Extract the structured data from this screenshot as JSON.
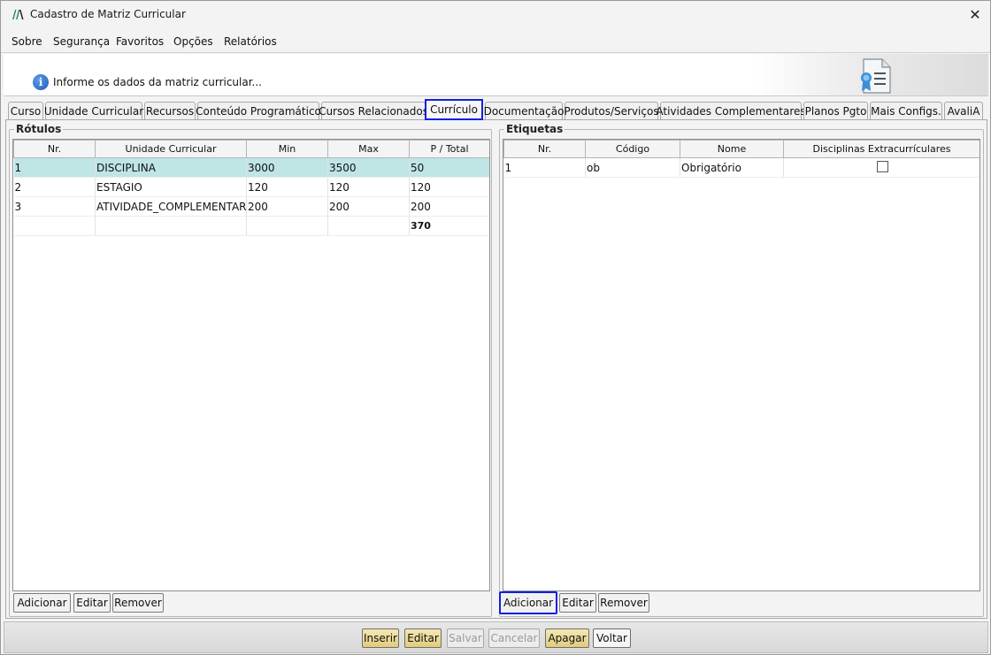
{
  "window": {
    "title": "Cadastro de Matriz Curricular",
    "close_glyph": "✕"
  },
  "menu": [
    {
      "label": "Sobre"
    },
    {
      "label": "Segurança"
    },
    {
      "label": "Favoritos"
    },
    {
      "label": "Opções"
    },
    {
      "label": "Relatórios"
    }
  ],
  "info": {
    "text": "Informe os dados da matriz curricular...",
    "icon": "info-icon",
    "illustration": "certificate-document-icon"
  },
  "tabs": [
    {
      "label": "Curso",
      "active": false
    },
    {
      "label": "Unidade Curricular",
      "active": false
    },
    {
      "label": "Recursos",
      "active": false
    },
    {
      "label": "Conteúdo Programático",
      "active": false
    },
    {
      "label": "Cursos Relacionados",
      "active": false
    },
    {
      "label": "Currículo",
      "active": true
    },
    {
      "label": "Documentação",
      "active": false
    },
    {
      "label": "Produtos/Serviços",
      "active": false
    },
    {
      "label": "Atividades Complementares",
      "active": false
    },
    {
      "label": "Planos Pgto",
      "active": false
    },
    {
      "label": "Mais Configs.",
      "active": false
    },
    {
      "label": "AvaliA",
      "active": false
    }
  ],
  "rotulos": {
    "title": "Rótulos",
    "columns": [
      "Nr.",
      "Unidade Curricular",
      "Min",
      "Max",
      "P / Total"
    ],
    "rows": [
      {
        "nr": "1",
        "unidade": "DISCIPLINA",
        "min": "3000",
        "max": "3500",
        "total": "50"
      },
      {
        "nr": "2",
        "unidade": "ESTAGIO",
        "min": "120",
        "max": "120",
        "total": "120"
      },
      {
        "nr": "3",
        "unidade": "ATIVIDADE_COMPLEMENTAR",
        "min": "200",
        "max": "200",
        "total": "200"
      }
    ],
    "total_row": {
      "nr": "",
      "unidade": "",
      "min": "",
      "max": "",
      "total": "370"
    },
    "buttons": {
      "add": "Adicionar",
      "edit": "Editar",
      "remove": "Remover"
    }
  },
  "etiquetas": {
    "title": "Etiquetas",
    "columns": [
      "Nr.",
      "Código",
      "Nome",
      "Disciplinas Extracurrículares"
    ],
    "rows": [
      {
        "nr": "1",
        "codigo": "ob",
        "nome": "Obrigatório",
        "extracurricular": false
      }
    ],
    "buttons": {
      "add": "Adicionar",
      "edit": "Editar",
      "remove": "Remover"
    }
  },
  "actions": {
    "insert": "Inserir",
    "edit": "Editar",
    "save": "Salvar",
    "cancel": "Cancelar",
    "delete": "Apagar",
    "back": "Voltar"
  },
  "colors": {
    "focus_border": "#1220e0",
    "selected_row": "#bfe5e5",
    "action_gold": "#e1cc7c"
  }
}
